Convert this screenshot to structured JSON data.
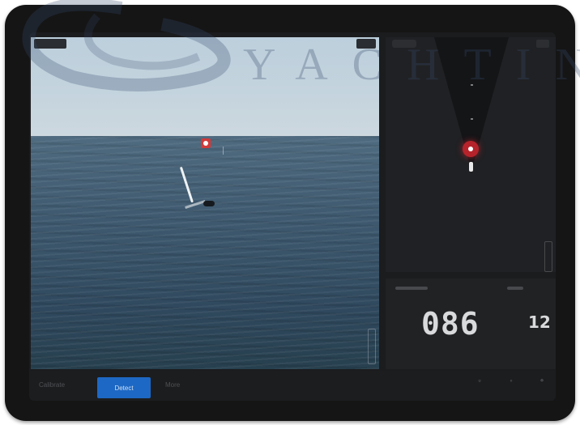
{
  "watermark": {
    "text": "YACHTING"
  },
  "readout": {
    "bearing": "086",
    "range": "12"
  },
  "bottombar": {
    "calibrate_label": "Calibrate",
    "detect_label": "Detect",
    "more_label": "More"
  },
  "icons": {
    "camera_menu": "camera-menu-icon",
    "radar_settings": "radar-settings-icon",
    "target": "target-icon",
    "own_boat": "own-boat-icon"
  },
  "colors": {
    "accent": "#1d68c4",
    "target": "#b6232b",
    "panel": "#202124"
  }
}
